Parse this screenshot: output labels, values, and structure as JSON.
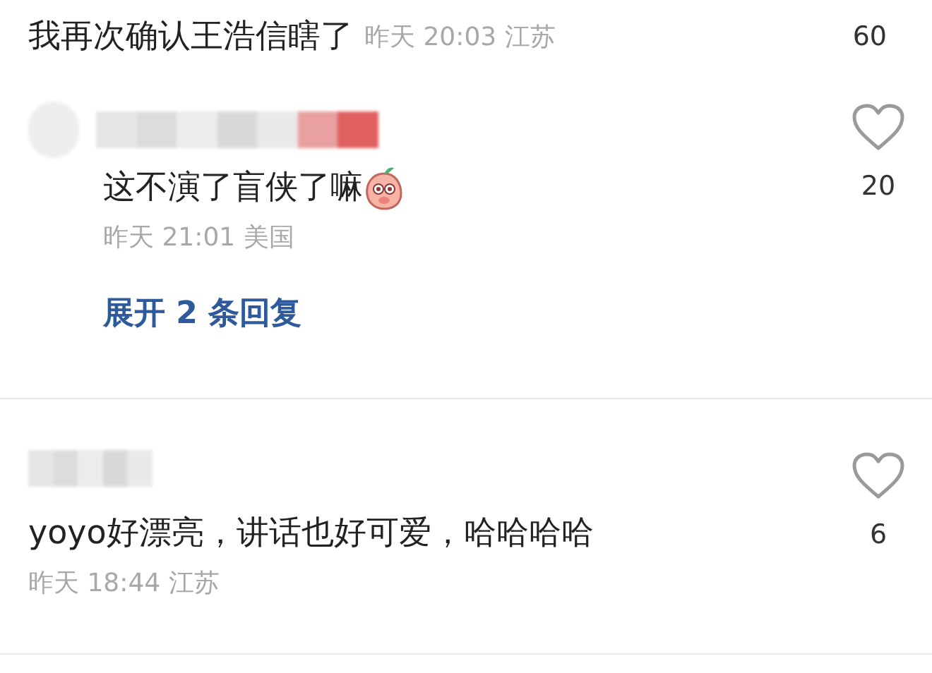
{
  "comments": [
    {
      "kind": "top",
      "text": "我再次确认王浩信瞎了",
      "meta": "昨天 20:03 江苏",
      "likes": "60"
    },
    {
      "kind": "reply",
      "text": "这不演了盲侠了嘛",
      "meta": "昨天 21:01 美国",
      "likes": "20",
      "liked": false,
      "expand": "展开 2 条回复"
    },
    {
      "kind": "plain",
      "text": "yoyo好漂亮，讲话也好可爱，哈哈哈哈",
      "meta": "昨天 18:44 江苏",
      "likes": "6",
      "liked": false
    }
  ]
}
